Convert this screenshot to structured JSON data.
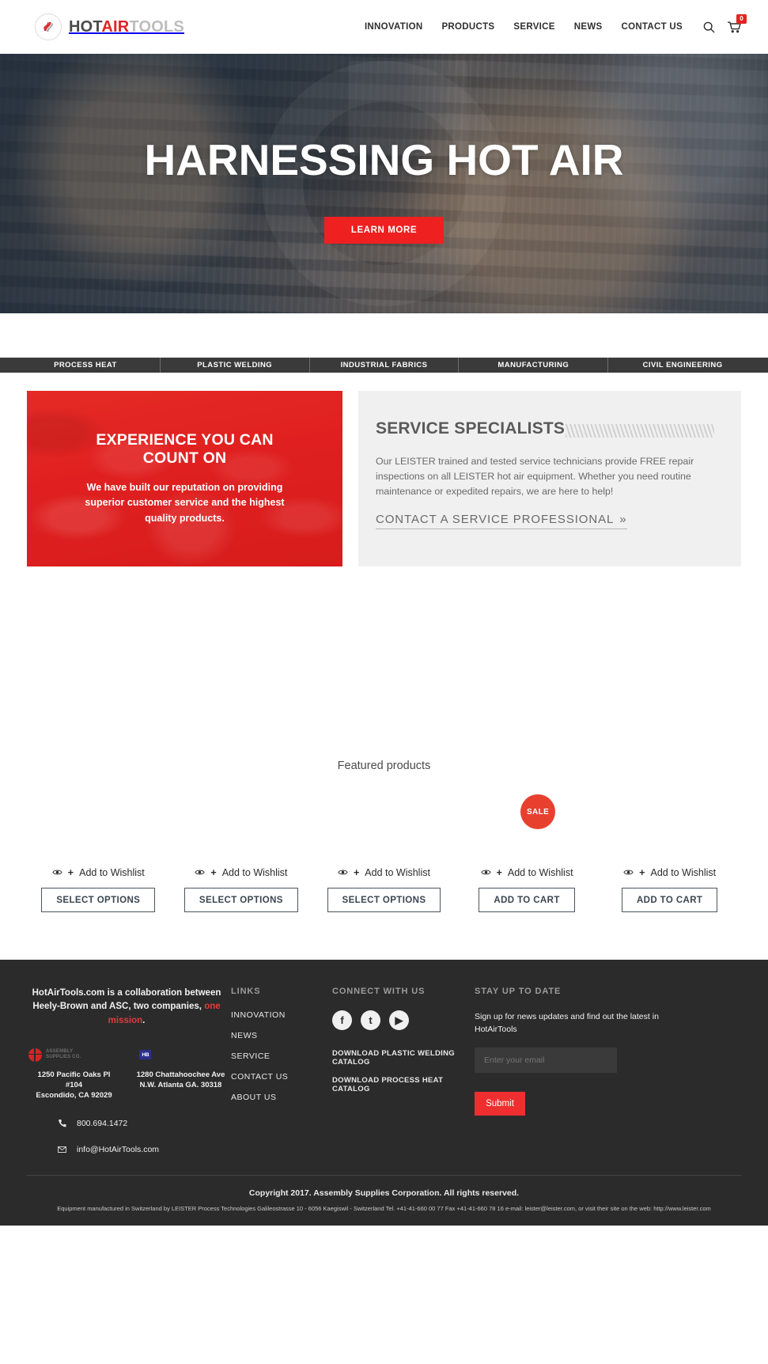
{
  "header": {
    "logo": {
      "part1": "HOT",
      "part2": "AIR",
      "part3": "TOOLS",
      "icon": "flame-swoosh-logo-icon"
    },
    "nav": [
      {
        "label": "INNOVATION"
      },
      {
        "label": "PRODUCTS"
      },
      {
        "label": "SERVICE"
      },
      {
        "label": "NEWS"
      },
      {
        "label": "CONTACT US"
      }
    ],
    "search_icon": "search-icon",
    "cart_icon": "shopping-cart-icon",
    "cart_count": "0"
  },
  "hero": {
    "title": "HARNESSING HOT AIR",
    "button": "LEARN MORE"
  },
  "categories": [
    {
      "label": "PROCESS HEAT"
    },
    {
      "label": "PLASTIC WELDING"
    },
    {
      "label": "INDUSTRIAL FABRICS"
    },
    {
      "label": "MANUFACTURING"
    },
    {
      "label": "CIVIL ENGINEERING"
    }
  ],
  "promo": {
    "title": "EXPERIENCE YOU CAN COUNT ON",
    "body": "We have built our reputation on providing superior customer service and the highest quality products."
  },
  "service": {
    "title": "SERVICE SPECIALISTS",
    "body": "Our LEISTER trained and tested service technicians provide FREE repair inspections on all LEISTER hot air equipment. Whether you need routine maintenance or expedited repairs, we are here to help!",
    "link": "CONTACT A SERVICE PROFESSIONAL",
    "link_chevron": "»"
  },
  "featured": {
    "title": "Featured products",
    "sale_badge": "SALE",
    "wishlist_label": "Add to Wishlist",
    "wishlist_plus": "+",
    "eye_icon": "eye-icon",
    "products": [
      {
        "button": "SELECT OPTIONS",
        "on_sale": false
      },
      {
        "button": "SELECT OPTIONS",
        "on_sale": false
      },
      {
        "button": "SELECT OPTIONS",
        "on_sale": false
      },
      {
        "button": "ADD TO CART",
        "on_sale": true
      },
      {
        "button": "ADD TO CART",
        "on_sale": false
      }
    ]
  },
  "footer": {
    "about": {
      "lead_1": "HotAirTools.com is a collaboration between Heely-Brown and ASC, two companies, ",
      "mission": "one mission",
      "lead_2": ".",
      "asc_logo_text_1": "ASSEMBLY",
      "asc_logo_text_2": "SUPPLIES CO.",
      "hb_logo_text": "HB",
      "address_1": "1250 Pacific Oaks Pl #104\nEscondido, CA 92029",
      "address_2": "1280 Chattahoochee Ave\nN.W. Atlanta GA. 30318",
      "phone": "800.694.1472",
      "phone_icon": "phone-icon",
      "email": "info@HotAirTools.com",
      "email_icon": "envelope-icon"
    },
    "links": {
      "heading": "LINKS",
      "items": [
        {
          "label": "INNOVATION"
        },
        {
          "label": "NEWS"
        },
        {
          "label": "SERVICE"
        },
        {
          "label": "CONTACT US"
        },
        {
          "label": "ABOUT US"
        }
      ]
    },
    "connect": {
      "heading": "CONNECT WITH US",
      "socials": [
        {
          "name": "facebook-icon",
          "glyph": "f"
        },
        {
          "name": "twitter-icon",
          "glyph": "t"
        },
        {
          "name": "youtube-icon",
          "glyph": "▶"
        }
      ],
      "catalogs": [
        {
          "label": "DOWNLOAD PLASTIC WELDING CATALOG"
        },
        {
          "label": "DOWNLOAD PROCESS HEAT CATALOG"
        }
      ]
    },
    "newsletter": {
      "heading": "STAY UP TO DATE",
      "subtext": "Sign up for news updates and find out the latest in HotAirTools",
      "placeholder": "Enter your email",
      "value": "",
      "submit": "Submit"
    },
    "copyright": "Copyright 2017. Assembly Supplies Corporation. All rights reserved.",
    "legal": "Equipment manufactured in Switzerland by LEISTER Process Technologies Galileostrasse 10 - 6056 Kaegiswil - Switzerland Tel. +41-41-660 00 77 Fax +41-41-660 78 16 e-mail: leister@leister.com, or visit their site on the web: http://www.leister.com"
  },
  "colors": {
    "brand_red": "#e02424",
    "hero_btn": "#ef2020",
    "dark_bar": "#3a3a3a",
    "footer_bg": "#2b2b2b"
  }
}
